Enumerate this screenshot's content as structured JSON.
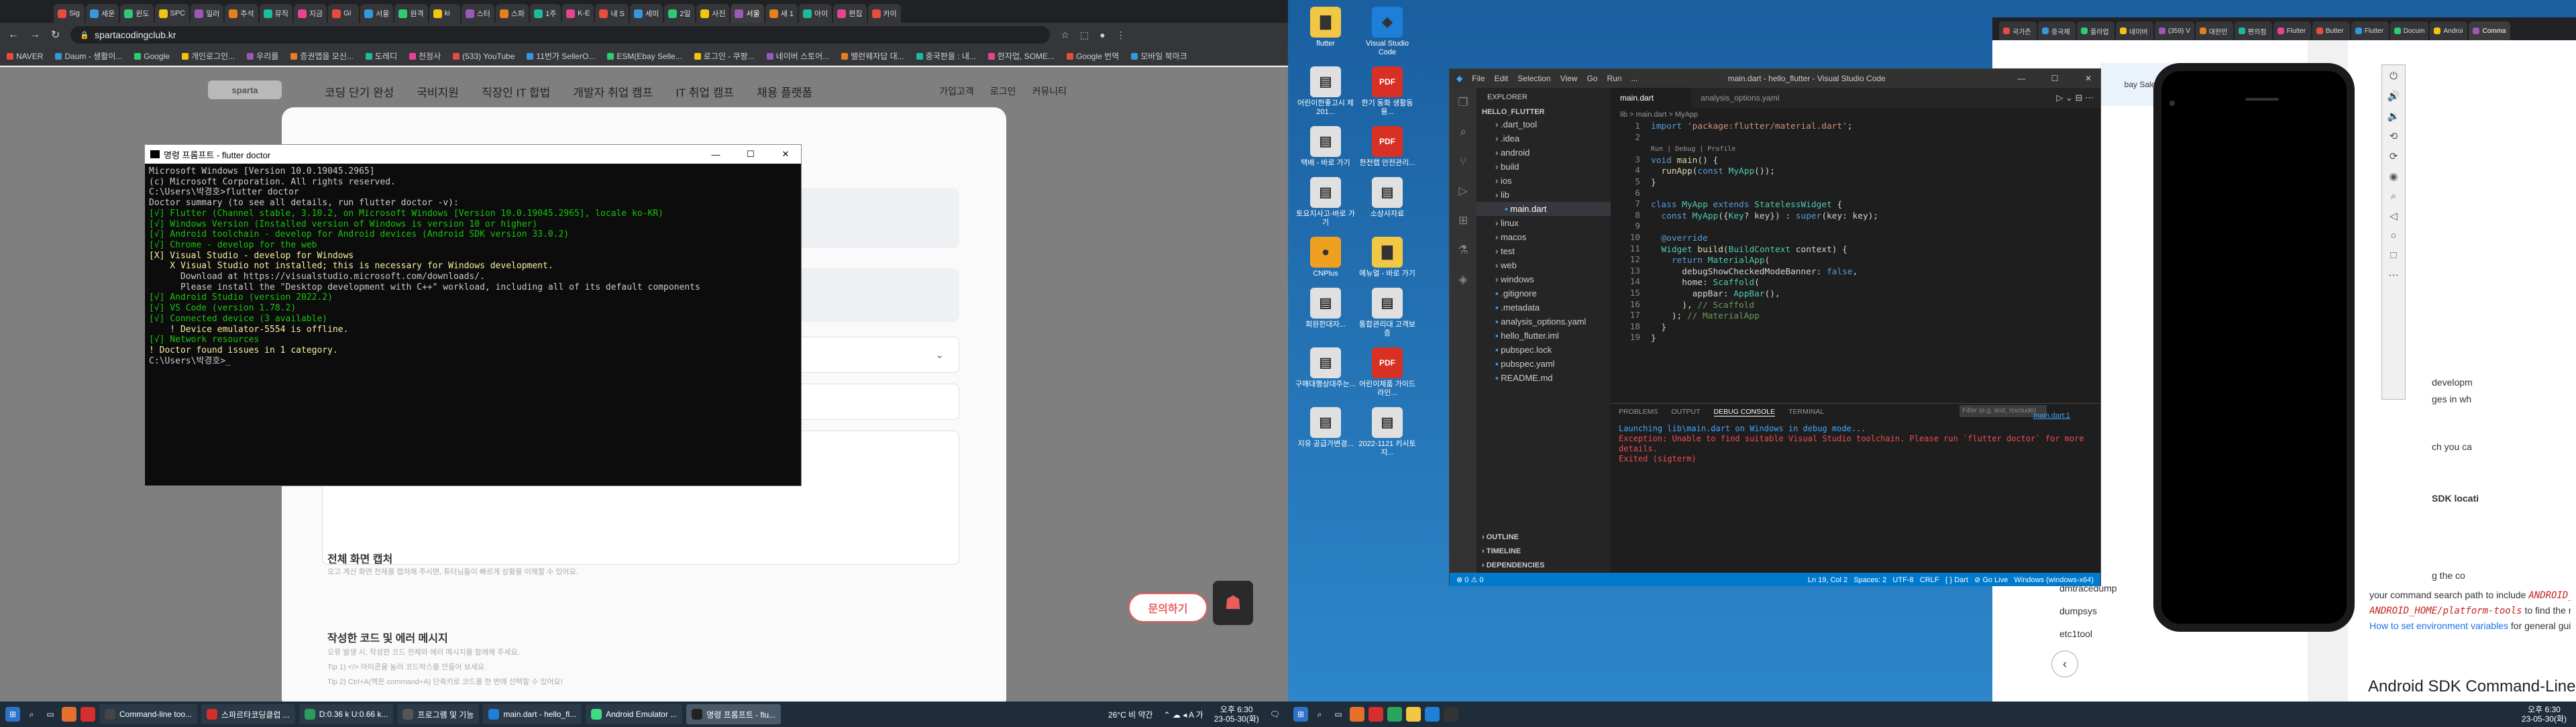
{
  "chrome": {
    "tabs": [
      "Sig",
      "세운",
      "윈도",
      "SPC",
      "일러",
      "추석",
      "뮤직",
      "지금",
      "GI",
      "서울",
      "원격",
      "ki",
      "스터",
      "스파",
      "1주",
      "K-E",
      "내 S",
      "세미",
      "2일",
      "사진",
      "서울",
      "새 1",
      "아이",
      "편집",
      "카이"
    ],
    "url": "spartacodingclub.kr",
    "bookmarks": [
      "NAVER",
      "Daum - 생활이...",
      "Google",
      "개인로그인...",
      "우리를",
      "증권앱을 모신...",
      "도레디",
      "천정사",
      "(533) YouTube",
      "11번가 SellerO...",
      "ESM(Ebay Selle...",
      "로그인 - 쿠팡...",
      "네이버 스토어...",
      "밸런웨자답 대...",
      "중국판을 : 내...",
      "한자업, SOME...",
      "Google 번역",
      "모바일 북마크"
    ]
  },
  "site": {
    "nav": [
      "코딩 단기 완성",
      "국비지원",
      "직장인 IT 합법",
      "개발자 취업 캠프",
      "IT 취업 캠프",
      "채용 플랫폼"
    ],
    "right_nav": [
      "가입고객",
      "로그인",
      "커뮤니티"
    ],
    "select_placeholder": "선택",
    "section_screen_title": "전체 화면 캡처",
    "section_screen_desc": "오고 계신 화면 전체를 캡처해 주시면, 튜터님들이 빠르게 상황을 이해할 수 있어요.",
    "section_code_title": "작성한 코드 및 에러 메시지",
    "section_code_desc": "오류 발생 시, 작성한 코드 전체와 에러 메시지를 함께해 주세요.",
    "tip1": "Tip 1) </> 아이콘을 눌러 코드박스를 만들어 보세요.",
    "tip2": "Tip 2) Ctrl+A(맥은 command+A) 단축키로 코드를 한 번에 선택할 수 있어요!",
    "ask_button": "문의하기"
  },
  "cmd": {
    "title": "명령 프롬프트 - flutter  doctor",
    "lines": [
      {
        "t": "Microsoft Windows [Version 10.0.19045.2965]",
        "c": ""
      },
      {
        "t": "(c) Microsoft Corporation. All rights reserved.",
        "c": ""
      },
      {
        "t": "",
        "c": ""
      },
      {
        "t": "C:\\Users\\박경호>flutter doctor",
        "c": ""
      },
      {
        "t": "Doctor summary (to see all details, run flutter doctor -v):",
        "c": ""
      },
      {
        "t": "[√] Flutter (Channel stable, 3.10.2, on Microsoft Windows [Version 10.0.19045.2965], locale ko-KR)",
        "c": "g"
      },
      {
        "t": "[√] Windows Version (Installed version of Windows is version 10 or higher)",
        "c": "g"
      },
      {
        "t": "[√] Android toolchain - develop for Android devices (Android SDK version 33.0.2)",
        "c": "g"
      },
      {
        "t": "[√] Chrome - develop for the web",
        "c": "g"
      },
      {
        "t": "[X] Visual Studio - develop for Windows",
        "c": "y"
      },
      {
        "t": "    X Visual Studio not installed; this is necessary for Windows development.",
        "c": "y"
      },
      {
        "t": "      Download at https://visualstudio.microsoft.com/downloads/.",
        "c": ""
      },
      {
        "t": "      Please install the \"Desktop development with C++\" workload, including all of its default components",
        "c": ""
      },
      {
        "t": "[√] Android Studio (version 2022.2)",
        "c": "g"
      },
      {
        "t": "[√] VS Code (version 1.78.2)",
        "c": "g"
      },
      {
        "t": "[√] Connected device (3 available)",
        "c": "g"
      },
      {
        "t": "    ! Device emulator-5554 is offline.",
        "c": "y"
      },
      {
        "t": "[√] Network resources",
        "c": "g"
      },
      {
        "t": "",
        "c": ""
      },
      {
        "t": "! Doctor found issues in 1 category.",
        "c": "y"
      },
      {
        "t": "",
        "c": ""
      },
      {
        "t": "C:\\Users\\박경호>_",
        "c": ""
      }
    ]
  },
  "taskbar_left": {
    "items": [
      "Command-line too...",
      "스파르타코딩클럽 ...",
      "D:0.36 k U:0.66 k...",
      "프로그램 및 기능",
      "main.dart - hello_fl...",
      "Android Emulator ...",
      "명령 프롬프트 - flu..."
    ],
    "weather": "26°C 비 약간",
    "time": "오후 6:30",
    "date": "23-05-30(화)"
  },
  "taskbar_right": {
    "time": "오후 6:30",
    "date": "23-05-30(화)"
  },
  "desktop_icons": [
    {
      "label": "flutter",
      "color": "#f2c744",
      "glyph": "▇"
    },
    {
      "label": "Visual Studio Code",
      "color": "#1d7fd8",
      "glyph": "◆"
    },
    {
      "label": "어린이한좋고시 제201...",
      "color": "#e0e0e0",
      "glyph": "▤"
    },
    {
      "label": "한기 동화 생활동용...",
      "color": "#d93025",
      "glyph": "PDF"
    },
    {
      "label": "택배 - 바로 가기",
      "color": "#e0e0e0",
      "glyph": "▤"
    },
    {
      "label": "한전랩 안전관리...",
      "color": "#d93025",
      "glyph": "PDF"
    },
    {
      "label": "토요지사고-바로 가기",
      "color": "#e0e0e0",
      "glyph": "▤"
    },
    {
      "label": "소상사자료",
      "color": "#e0e0e0",
      "glyph": "▤"
    },
    {
      "label": "CNPlus",
      "color": "#f0a020",
      "glyph": "●"
    },
    {
      "label": "에뉴얼 - 바로 가기",
      "color": "#f2c744",
      "glyph": "▇"
    },
    {
      "label": "회원한대자...",
      "color": "#e0e0e0",
      "glyph": "▤"
    },
    {
      "label": "통합관리대 고객보증",
      "color": "#e0e0e0",
      "glyph": "▤"
    },
    {
      "label": "구매대행상대주는...",
      "color": "#e0e0e0",
      "glyph": "▤"
    },
    {
      "label": "어린이제품 가이드라인...",
      "color": "#d93025",
      "glyph": "PDF"
    },
    {
      "label": "지유 공급가변경...",
      "color": "#e0e0e0",
      "glyph": "▤"
    },
    {
      "label": "2022-1121 키시토지...",
      "color": "#e0e0e0",
      "glyph": "▤"
    }
  ],
  "right_chrome_tabs": [
    "국가즌",
    "중국제",
    "플라업",
    "네이버",
    "(359) V",
    "대한민",
    "편의점",
    "Flutter",
    "Butter",
    "Flutter",
    "Docum",
    "Androi",
    "Comma"
  ],
  "vscode": {
    "title": "main.dart - hello_flutter - Visual Studio Code",
    "menu": [
      "File",
      "Edit",
      "Selection",
      "View",
      "Go",
      "Run",
      "..."
    ],
    "explorer_title": "EXPLORER",
    "project": "HELLO_FLUTTER",
    "files": [
      ".dart_tool",
      ".idea",
      "android",
      "build",
      "ios",
      "lib",
      "main.dart",
      "linux",
      "macos",
      "test",
      "web",
      "windows",
      ".gitignore",
      ".metadata",
      "analysis_options.yaml",
      "hello_flutter.iml",
      "pubspec.lock",
      "pubspec.yaml",
      "README.md"
    ],
    "tabs": [
      "main.dart",
      "analysis_options.yaml"
    ],
    "breadcrumb": "lib > main.dart > MyApp",
    "codelens": "Run | Debug | Profile",
    "panel_tabs": [
      "PROBLEMS",
      "OUTPUT",
      "DEBUG CONSOLE",
      "TERMINAL"
    ],
    "filter_placeholder": "Filter (e.g. text, !exclude)",
    "console": [
      "Launching lib\\main.dart on Windows in debug mode...",
      "Exception: Unable to find suitable Visual Studio toolchain. Please run `flutter doctor` for more details.",
      "Exited (sigterm)"
    ],
    "console_link": "main.dart:1",
    "outline": [
      "OUTLINE",
      "TIMELINE",
      "DEPENDENCIES"
    ],
    "status_left": "⊗ 0 ⚠ 0",
    "status_right": "Ln 19, Col 2   Spaces: 2   UTF-8   CRLF   { } Dart   ⊘ Go Live   Windows (windows-x64)"
  },
  "browser_bg": {
    "sidebar": [
      "dmtracedump",
      "dumpsys",
      "etc1tool"
    ],
    "text_a": "developm",
    "text_b": "ges in wh",
    "text_c": "ch you ca",
    "text_d": "SDK locati",
    "text_e": "g the co",
    "line1_prefix": "your command search path to include ",
    "line1_code": "ANDROID_HOME/tools, ANDROID_HOME/too",
    "line2_code": "ANDROID_HOME/platform-tools",
    "line2_suffix": " to find the most common tools. The steps vary depen",
    "line3_link": "How to set environment variables",
    "line3_suffix": " for general guidance.",
    "heading": "Android SDK Command-Line Tools"
  }
}
